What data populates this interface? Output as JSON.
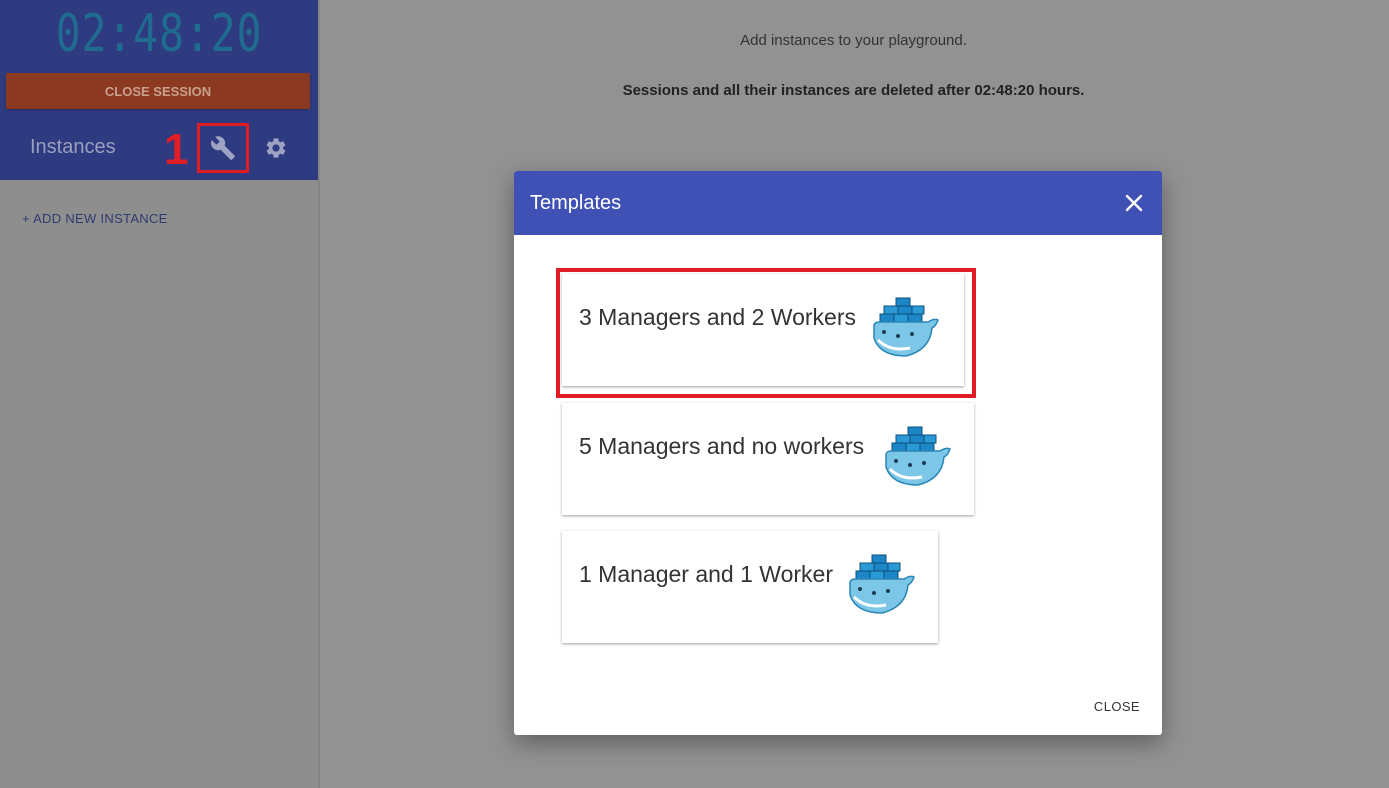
{
  "sidebar": {
    "clock": "02:48:20",
    "close_session_label": "CLOSE SESSION",
    "instances_label": "Instances",
    "annotation_number": "1",
    "add_instance_label": "+ ADD NEW INSTANCE",
    "icons": [
      "wrench-icon",
      "gear-icon"
    ]
  },
  "main": {
    "hint": "Add instances to your playground.",
    "session_notice": "Sessions and all their instances are deleted after 02:48:20 hours."
  },
  "dialog": {
    "title": "Templates",
    "close_label": "CLOSE",
    "templates": [
      {
        "label": "3 Managers and 2 Workers",
        "icon": "docker-swarm-whale-icon"
      },
      {
        "label": "5 Managers and no workers",
        "icon": "docker-swarm-whale-icon"
      },
      {
        "label": "1 Manager and 1 Worker",
        "icon": "docker-swarm-whale-icon"
      }
    ]
  },
  "colors": {
    "sidebar_header": "#2f3b81",
    "close_session": "#8b3a21",
    "dialog_header": "#3f51b5",
    "annotation_red": "#e01d25",
    "overlay": "#929292"
  }
}
